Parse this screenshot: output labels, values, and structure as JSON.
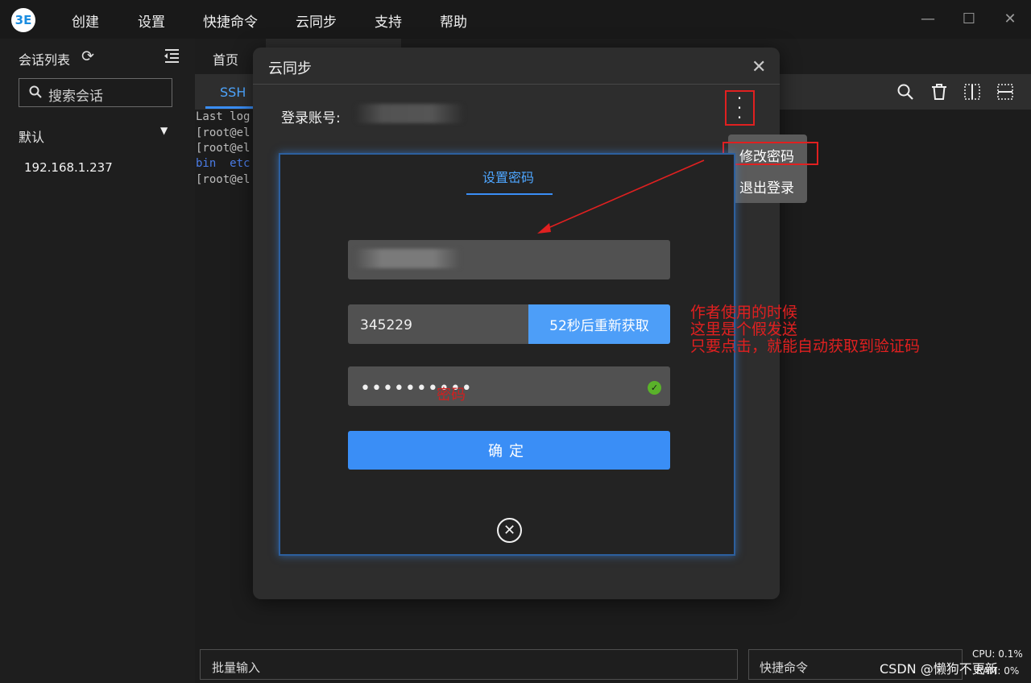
{
  "app": {
    "logo_text": "3E",
    "menu": [
      "创建",
      "设置",
      "快捷命令",
      "云同步",
      "支持",
      "帮助"
    ],
    "window_controls": [
      "minimize-icon",
      "maximize-icon",
      "close-icon"
    ]
  },
  "sidebar": {
    "title": "会话列表",
    "search_placeholder": "搜索会话",
    "group": "默认",
    "hosts": [
      "192.168.1.237"
    ]
  },
  "main": {
    "home_tab": "首页",
    "ssh_tab": "SSH",
    "toolbar_icons": [
      "search-icon",
      "trash-icon",
      "split-vertical-icon",
      "split-horizontal-icon"
    ],
    "terminal_lines": [
      "Last log",
      "[root@el",
      "[root@el",
      "bin  etc",
      "[root@el"
    ]
  },
  "footer": {
    "batch_input": "批量输入",
    "quick_command": "快捷命令",
    "watermark": "CSDN @懒狗不更新",
    "cpu": "CPU: 0.1%",
    "ram": "RAM: 0%"
  },
  "modal": {
    "title": "云同步",
    "account_label": "登录账号:",
    "dropdown": [
      "修改密码",
      "退出登录"
    ],
    "inner": {
      "tab": "设置密码",
      "code_value": "345229",
      "resend_label": "52秒后重新获取",
      "password_masked": "••••••••••",
      "password_hint": "密码",
      "confirm_label": "确定"
    }
  },
  "annotation": {
    "lines": [
      "作者使用的时候",
      "这里是个假发送",
      "只要点击，就能自动获取到验证码"
    ],
    "color": "#e02020"
  },
  "colors": {
    "accent": "#3a8ef6",
    "success": "#5ab22a"
  }
}
